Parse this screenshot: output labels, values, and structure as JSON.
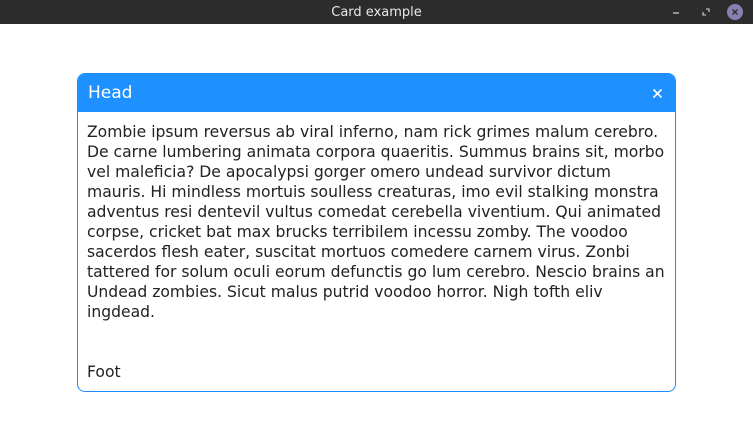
{
  "window": {
    "title": "Card example"
  },
  "titlebar_buttons": {
    "minimize_icon": "minimize-icon",
    "maximize_icon": "restore-icon",
    "close_icon": "close-icon"
  },
  "card": {
    "head": "Head",
    "close_icon": "close-icon",
    "body": "Zombie ipsum reversus ab viral inferno, nam rick grimes malum cerebro. De carne lumbering animata corpora quaeritis. Summus brains sit, morbo vel maleficia? De apocalypsi gorger omero undead survivor dictum mauris. Hi mindless mortuis soulless creaturas, imo evil stalking monstra adventus resi dentevil vultus comedat cerebella viventium. Qui animated corpse, cricket bat max brucks terribilem incessu zomby. The voodoo sacerdos flesh eater, suscitat mortuos comedere carnem virus. Zonbi tattered for solum oculi eorum defunctis go lum cerebro. Nescio brains an Undead zombies. Sicut malus putrid voodoo horror. Nigh tofth eliv ingdead.",
    "foot": "Foot"
  },
  "colors": {
    "titlebar": "#2c2c2c",
    "card_head": "#1e90ff",
    "card_border": "#1e8cff",
    "close_button": "#8a7fb2"
  }
}
